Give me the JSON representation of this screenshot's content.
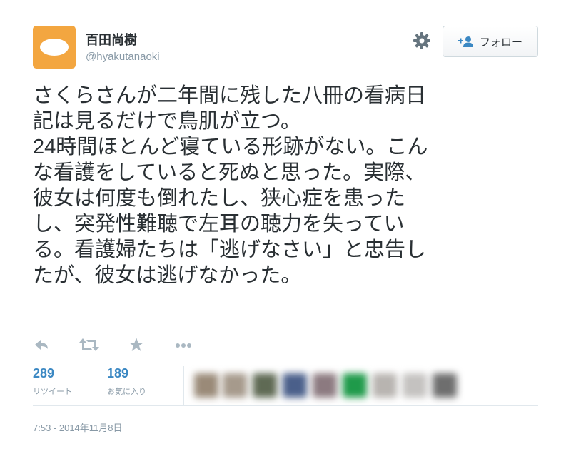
{
  "user": {
    "display_name": "百田尚樹",
    "handle": "@hyakutanaoki",
    "avatar_icon": "default-egg-avatar",
    "avatar_color": "#f3a640"
  },
  "header": {
    "settings_icon": "gear-icon",
    "follow_label": "フォロー",
    "follow_icon": "add-user-icon"
  },
  "tweet": {
    "text": "さくらさんが二年間に残した八冊の看病日\n記は見るだけで鳥肌が立つ。\n24時間ほとんど寝ている形跡がない。こん\nな看護をしていると死ぬと思った。実際、\n彼女は何度も倒れたし、狭心症を患った\nし、突発性難聴で左耳の聴力を失ってい\nる。看護婦たちは「逃げなさい」と忠告し\nたが、彼女は逃げなかった。"
  },
  "actions": [
    {
      "name": "reply-icon"
    },
    {
      "name": "retweet-icon"
    },
    {
      "name": "favorite-icon"
    },
    {
      "name": "more-icon"
    }
  ],
  "stats": {
    "retweets": "289",
    "retweets_label": "リツイート",
    "favorites": "189",
    "favorites_label": "お気に入り"
  },
  "timestamp": "7:53 - 2014年11月8日",
  "colors": {
    "link": "#3b88c3",
    "muted": "#8899a6",
    "text": "#292f33"
  }
}
